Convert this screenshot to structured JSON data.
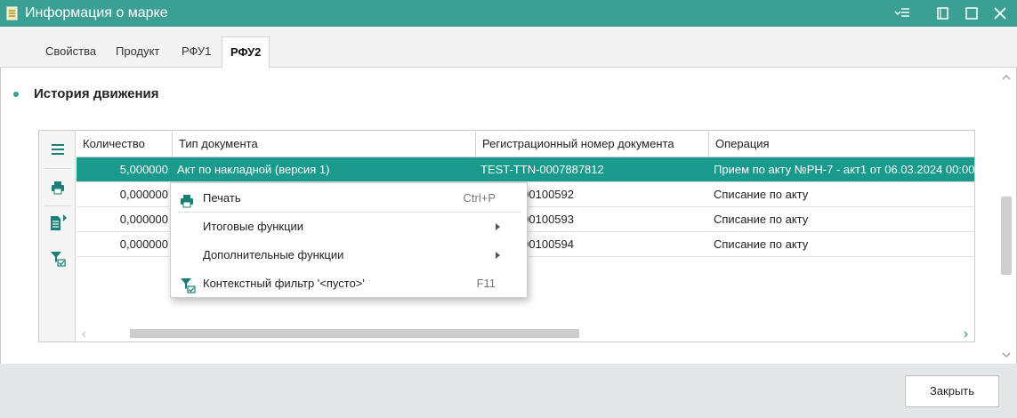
{
  "window": {
    "title": "Информация о марке",
    "icon": "document-icon",
    "controls": [
      "menu-list-icon",
      "restore-icon",
      "maximize-icon",
      "close-icon"
    ]
  },
  "tabs": [
    {
      "label": "Свойства",
      "active": false
    },
    {
      "label": "Продукт",
      "active": false
    },
    {
      "label": "РФУ1",
      "active": false
    },
    {
      "label": "РФУ2",
      "active": true
    }
  ],
  "section": {
    "title": "История движения"
  },
  "grid": {
    "toolbar": [
      "menu-icon",
      "printer-icon",
      "export-list-icon",
      "filter-check-icon"
    ],
    "columns": [
      "Количество",
      "Тип документа",
      "Регистрационный номер документа",
      "Операция"
    ],
    "rows": [
      {
        "qty": "5,000000",
        "doc_type": "Акт по накладной (версия 1)",
        "reg_num": "TEST-TTN-0007887812",
        "operation": "Прием по акту  №РН-7 - акт1 от 06.03.2024 00:00",
        "selected": true
      },
      {
        "qty": "0,000000",
        "doc_type": "",
        "reg_num": "F-0000100592",
        "operation": "Списание по акту",
        "selected": false
      },
      {
        "qty": "0,000000",
        "doc_type": "",
        "reg_num": "F-0000100593",
        "operation": "Списание по акту",
        "selected": false
      },
      {
        "qty": "0,000000",
        "doc_type": "",
        "reg_num": "F-0000100594",
        "operation": "Списание по акту",
        "selected": false
      }
    ]
  },
  "context_menu": {
    "items": [
      {
        "label": "Печать",
        "shortcut": "Ctrl+P",
        "icon": "printer-icon",
        "submenu": false
      },
      {
        "label": "Итоговые функции",
        "shortcut": "",
        "icon": "",
        "submenu": true
      },
      {
        "label": "Дополнительные функции",
        "shortcut": "",
        "icon": "",
        "submenu": true
      },
      {
        "label": "Контекстный фильтр '<пусто>'",
        "shortcut": "F11",
        "icon": "filter-check-icon",
        "submenu": false
      }
    ]
  },
  "footer": {
    "close_label": "Закрыть"
  },
  "colors": {
    "accent": "#3b9f94",
    "selection": "#1a9a8c",
    "footer_bg": "#e2e8e8"
  }
}
